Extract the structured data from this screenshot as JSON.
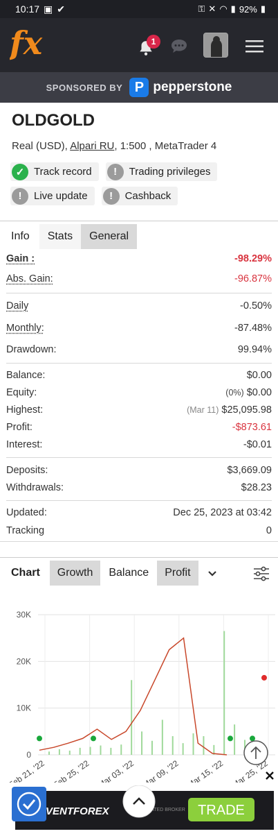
{
  "status_bar": {
    "time": "10:17",
    "battery": "92%"
  },
  "app_bar": {
    "logo_text": "fx",
    "notification_count": "1"
  },
  "sponsor": {
    "label": "SPONSORED BY",
    "brand": "pepperstone"
  },
  "account": {
    "name": "OLDGOLD",
    "type": "Real (USD), ",
    "broker": "Alpari RU",
    "details": ", 1:500 , MetaTrader 4",
    "chips": [
      {
        "label": "Track record",
        "status": "ok"
      },
      {
        "label": "Trading privileges",
        "status": "warn"
      },
      {
        "label": "Live update",
        "status": "warn"
      },
      {
        "label": "Cashback",
        "status": "warn"
      }
    ]
  },
  "tabs": {
    "info": "Info",
    "stats": "Stats",
    "general": "General"
  },
  "stats": {
    "gain": {
      "label": "Gain :",
      "value": "-98.29%"
    },
    "abs_gain": {
      "label": "Abs. Gain:",
      "value": "-96.87%"
    },
    "daily": {
      "label": "Daily",
      "value": "-0.50%"
    },
    "monthly": {
      "label": "Monthly:",
      "value": "-87.48%"
    },
    "drawdown": {
      "label": "Drawdown:",
      "value": "99.94%"
    },
    "balance": {
      "label": "Balance:",
      "value": "$0.00"
    },
    "equity": {
      "label": "Equity:",
      "note": "(0%)",
      "value": "$0.00"
    },
    "highest": {
      "label": "Highest:",
      "note": "(Mar 11)",
      "value": "$25,095.98"
    },
    "profit": {
      "label": "Profit:",
      "value": "-$873.61"
    },
    "interest": {
      "label": "Interest:",
      "value": "-$0.01"
    },
    "deposits": {
      "label": "Deposits:",
      "value": "$3,669.09"
    },
    "withdrawals": {
      "label": "Withdrawals:",
      "value": "$28.23"
    },
    "updated": {
      "label": "Updated:",
      "value": "Dec 25, 2023 at 03:42"
    },
    "tracking": {
      "label": "Tracking",
      "value": "0"
    }
  },
  "chart_tabs": {
    "chart": "Chart",
    "growth": "Growth",
    "balance": "Balance",
    "profit": "Profit"
  },
  "chart_data": {
    "type": "line",
    "y_ticks": [
      "30K",
      "20K",
      "10K",
      "0"
    ],
    "ylim": [
      0,
      30000
    ],
    "x_ticks": [
      "Feb 21, '22",
      "Feb 25, '22",
      "Mar 03, '22",
      "Mar 09, '22",
      "Mar 15, '22",
      "Mar 25, '22"
    ],
    "series": [
      {
        "values": [
          1000,
          1600,
          2500,
          3500,
          5500,
          3300,
          5000,
          9500,
          16000,
          22500,
          25000,
          2500,
          300,
          0
        ]
      }
    ],
    "bars": [
      700,
      1200,
      900,
      1500,
      1700,
      2000,
      1500,
      2200,
      16000,
      5000,
      3000,
      7500,
      4000,
      2500,
      4600,
      4000,
      2100,
      26500,
      6500,
      3200
    ],
    "colors": {
      "line": "#c8472a",
      "bar": "#9fd99a",
      "marker_green": "#19a83b",
      "marker_red": "#e02b2b"
    }
  },
  "ad": {
    "brand": "VENTFOREX",
    "cta": "TRADE",
    "tag": "REGULATED BROKER"
  }
}
